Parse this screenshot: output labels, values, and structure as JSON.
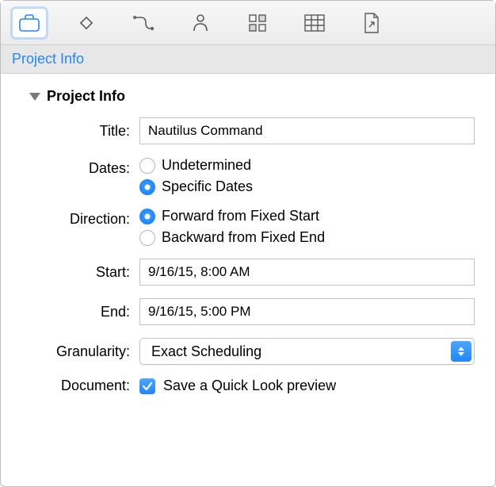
{
  "subtitle": "Project Info",
  "section": {
    "title": "Project Info",
    "fields": {
      "title": {
        "label": "Title:",
        "value": "Nautilus Command"
      },
      "dates": {
        "label": "Dates:",
        "options": {
          "undetermined": "Undetermined",
          "specific": "Specific Dates"
        },
        "selected": "specific"
      },
      "direction": {
        "label": "Direction:",
        "options": {
          "forward": "Forward from Fixed Start",
          "backward": "Backward from Fixed End"
        },
        "selected": "forward"
      },
      "start": {
        "label": "Start:",
        "value": "9/16/15, 8:00 AM"
      },
      "end": {
        "label": "End:",
        "value": "9/16/15, 5:00 PM"
      },
      "granularity": {
        "label": "Granularity:",
        "value": "Exact Scheduling"
      },
      "document": {
        "label": "Document:",
        "checkbox_label": "Save a Quick Look preview",
        "checked": true
      }
    }
  }
}
